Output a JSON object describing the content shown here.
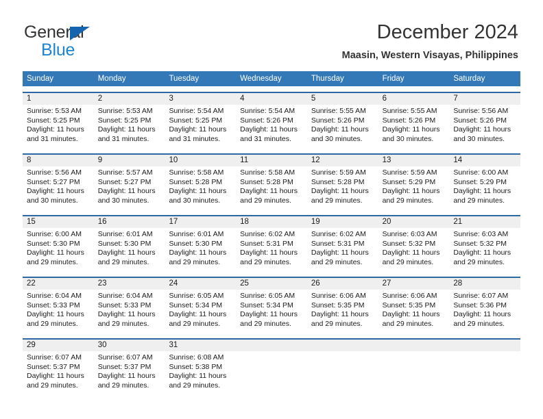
{
  "brand": {
    "name_top": "General",
    "name_bottom": "Blue",
    "triangle_color": "#1565AE",
    "text_color": "#333333",
    "blue_color": "#1D85D0"
  },
  "header": {
    "title": "December 2024",
    "subtitle": "Maasin, Western Visayas, Philippines"
  },
  "theme": {
    "header_bg": "#3379B8",
    "week_rule": "#2C68A4",
    "daynum_bg": "#EFEFEF",
    "cell_bg": "#FFFFFF",
    "text": "#1A1A1A"
  },
  "weekdays": [
    "Sunday",
    "Monday",
    "Tuesday",
    "Wednesday",
    "Thursday",
    "Friday",
    "Saturday"
  ],
  "weeks": [
    [
      {
        "day": "1",
        "sunrise": "Sunrise: 5:53 AM",
        "sunset": "Sunset: 5:25 PM",
        "daylight1": "Daylight: 11 hours",
        "daylight2": "and 31 minutes."
      },
      {
        "day": "2",
        "sunrise": "Sunrise: 5:53 AM",
        "sunset": "Sunset: 5:25 PM",
        "daylight1": "Daylight: 11 hours",
        "daylight2": "and 31 minutes."
      },
      {
        "day": "3",
        "sunrise": "Sunrise: 5:54 AM",
        "sunset": "Sunset: 5:25 PM",
        "daylight1": "Daylight: 11 hours",
        "daylight2": "and 31 minutes."
      },
      {
        "day": "4",
        "sunrise": "Sunrise: 5:54 AM",
        "sunset": "Sunset: 5:26 PM",
        "daylight1": "Daylight: 11 hours",
        "daylight2": "and 31 minutes."
      },
      {
        "day": "5",
        "sunrise": "Sunrise: 5:55 AM",
        "sunset": "Sunset: 5:26 PM",
        "daylight1": "Daylight: 11 hours",
        "daylight2": "and 30 minutes."
      },
      {
        "day": "6",
        "sunrise": "Sunrise: 5:55 AM",
        "sunset": "Sunset: 5:26 PM",
        "daylight1": "Daylight: 11 hours",
        "daylight2": "and 30 minutes."
      },
      {
        "day": "7",
        "sunrise": "Sunrise: 5:56 AM",
        "sunset": "Sunset: 5:26 PM",
        "daylight1": "Daylight: 11 hours",
        "daylight2": "and 30 minutes."
      }
    ],
    [
      {
        "day": "8",
        "sunrise": "Sunrise: 5:56 AM",
        "sunset": "Sunset: 5:27 PM",
        "daylight1": "Daylight: 11 hours",
        "daylight2": "and 30 minutes."
      },
      {
        "day": "9",
        "sunrise": "Sunrise: 5:57 AM",
        "sunset": "Sunset: 5:27 PM",
        "daylight1": "Daylight: 11 hours",
        "daylight2": "and 30 minutes."
      },
      {
        "day": "10",
        "sunrise": "Sunrise: 5:58 AM",
        "sunset": "Sunset: 5:28 PM",
        "daylight1": "Daylight: 11 hours",
        "daylight2": "and 30 minutes."
      },
      {
        "day": "11",
        "sunrise": "Sunrise: 5:58 AM",
        "sunset": "Sunset: 5:28 PM",
        "daylight1": "Daylight: 11 hours",
        "daylight2": "and 29 minutes."
      },
      {
        "day": "12",
        "sunrise": "Sunrise: 5:59 AM",
        "sunset": "Sunset: 5:28 PM",
        "daylight1": "Daylight: 11 hours",
        "daylight2": "and 29 minutes."
      },
      {
        "day": "13",
        "sunrise": "Sunrise: 5:59 AM",
        "sunset": "Sunset: 5:29 PM",
        "daylight1": "Daylight: 11 hours",
        "daylight2": "and 29 minutes."
      },
      {
        "day": "14",
        "sunrise": "Sunrise: 6:00 AM",
        "sunset": "Sunset: 5:29 PM",
        "daylight1": "Daylight: 11 hours",
        "daylight2": "and 29 minutes."
      }
    ],
    [
      {
        "day": "15",
        "sunrise": "Sunrise: 6:00 AM",
        "sunset": "Sunset: 5:30 PM",
        "daylight1": "Daylight: 11 hours",
        "daylight2": "and 29 minutes."
      },
      {
        "day": "16",
        "sunrise": "Sunrise: 6:01 AM",
        "sunset": "Sunset: 5:30 PM",
        "daylight1": "Daylight: 11 hours",
        "daylight2": "and 29 minutes."
      },
      {
        "day": "17",
        "sunrise": "Sunrise: 6:01 AM",
        "sunset": "Sunset: 5:30 PM",
        "daylight1": "Daylight: 11 hours",
        "daylight2": "and 29 minutes."
      },
      {
        "day": "18",
        "sunrise": "Sunrise: 6:02 AM",
        "sunset": "Sunset: 5:31 PM",
        "daylight1": "Daylight: 11 hours",
        "daylight2": "and 29 minutes."
      },
      {
        "day": "19",
        "sunrise": "Sunrise: 6:02 AM",
        "sunset": "Sunset: 5:31 PM",
        "daylight1": "Daylight: 11 hours",
        "daylight2": "and 29 minutes."
      },
      {
        "day": "20",
        "sunrise": "Sunrise: 6:03 AM",
        "sunset": "Sunset: 5:32 PM",
        "daylight1": "Daylight: 11 hours",
        "daylight2": "and 29 minutes."
      },
      {
        "day": "21",
        "sunrise": "Sunrise: 6:03 AM",
        "sunset": "Sunset: 5:32 PM",
        "daylight1": "Daylight: 11 hours",
        "daylight2": "and 29 minutes."
      }
    ],
    [
      {
        "day": "22",
        "sunrise": "Sunrise: 6:04 AM",
        "sunset": "Sunset: 5:33 PM",
        "daylight1": "Daylight: 11 hours",
        "daylight2": "and 29 minutes."
      },
      {
        "day": "23",
        "sunrise": "Sunrise: 6:04 AM",
        "sunset": "Sunset: 5:33 PM",
        "daylight1": "Daylight: 11 hours",
        "daylight2": "and 29 minutes."
      },
      {
        "day": "24",
        "sunrise": "Sunrise: 6:05 AM",
        "sunset": "Sunset: 5:34 PM",
        "daylight1": "Daylight: 11 hours",
        "daylight2": "and 29 minutes."
      },
      {
        "day": "25",
        "sunrise": "Sunrise: 6:05 AM",
        "sunset": "Sunset: 5:34 PM",
        "daylight1": "Daylight: 11 hours",
        "daylight2": "and 29 minutes."
      },
      {
        "day": "26",
        "sunrise": "Sunrise: 6:06 AM",
        "sunset": "Sunset: 5:35 PM",
        "daylight1": "Daylight: 11 hours",
        "daylight2": "and 29 minutes."
      },
      {
        "day": "27",
        "sunrise": "Sunrise: 6:06 AM",
        "sunset": "Sunset: 5:35 PM",
        "daylight1": "Daylight: 11 hours",
        "daylight2": "and 29 minutes."
      },
      {
        "day": "28",
        "sunrise": "Sunrise: 6:07 AM",
        "sunset": "Sunset: 5:36 PM",
        "daylight1": "Daylight: 11 hours",
        "daylight2": "and 29 minutes."
      }
    ],
    [
      {
        "day": "29",
        "sunrise": "Sunrise: 6:07 AM",
        "sunset": "Sunset: 5:37 PM",
        "daylight1": "Daylight: 11 hours",
        "daylight2": "and 29 minutes."
      },
      {
        "day": "30",
        "sunrise": "Sunrise: 6:07 AM",
        "sunset": "Sunset: 5:37 PM",
        "daylight1": "Daylight: 11 hours",
        "daylight2": "and 29 minutes."
      },
      {
        "day": "31",
        "sunrise": "Sunrise: 6:08 AM",
        "sunset": "Sunset: 5:38 PM",
        "daylight1": "Daylight: 11 hours",
        "daylight2": "and 29 minutes."
      },
      {
        "day": "",
        "sunrise": "",
        "sunset": "",
        "daylight1": "",
        "daylight2": ""
      },
      {
        "day": "",
        "sunrise": "",
        "sunset": "",
        "daylight1": "",
        "daylight2": ""
      },
      {
        "day": "",
        "sunrise": "",
        "sunset": "",
        "daylight1": "",
        "daylight2": ""
      },
      {
        "day": "",
        "sunrise": "",
        "sunset": "",
        "daylight1": "",
        "daylight2": ""
      }
    ]
  ]
}
